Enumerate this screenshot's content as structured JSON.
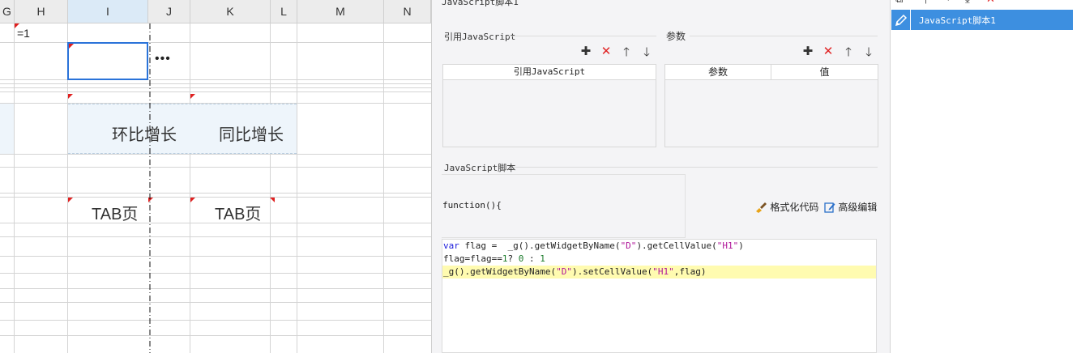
{
  "spreadsheet": {
    "columns": [
      "G",
      "H",
      "I",
      "J",
      "K",
      "L",
      "M",
      "N"
    ],
    "selected_column": "I",
    "cells": {
      "h1": "=1",
      "ellipsis": "•••",
      "i4": "环比增长",
      "k4": "同比增长",
      "i8": "TAB页",
      "k8": "TAB页"
    }
  },
  "panel": {
    "title": "JavaScript脚本1",
    "ref_section": {
      "title": "引用JavaScript",
      "table_header": "引用JavaScript"
    },
    "param_section": {
      "title": "参数",
      "headers": [
        "参数",
        "值"
      ]
    },
    "toolbar_icons": [
      "add-icon",
      "delete-icon",
      "move-up-icon",
      "move-down-icon"
    ],
    "toolbar_glyphs": {
      "add": "✚",
      "delete": "✕",
      "up": "🡑",
      "down": "🡓"
    },
    "script_section": {
      "title": "JavaScript脚本",
      "function_header": "function(){",
      "format_label": "格式化代码",
      "advanced_label": "高级编辑",
      "code": {
        "line1": {
          "kw": "var",
          "a": " flag =  _g().getWidgetByName(",
          "s1": "\"D\"",
          "b": ").getCellValue(",
          "s2": "\"H1\"",
          "c": ")"
        },
        "line2": {
          "a": "flag=flag==",
          "n1": "1",
          "b": "? ",
          "n2": "0",
          "c": " : ",
          "n3": "1"
        },
        "line3": {
          "a": "_g().getWidgetByName(",
          "s1": "\"D\"",
          "b": ").setCellValue(",
          "s2": "\"H1\"",
          "c": ",flag)"
        }
      }
    }
  },
  "right_panel": {
    "items": [
      {
        "label": "JavaScript脚本1",
        "selected": true
      }
    ],
    "toolbar_icons": [
      "copy-icon",
      "move-up-icon",
      "move-down-icon",
      "move-bottom-icon",
      "delete-icon"
    ]
  },
  "colors": {
    "accent": "#3d8fe0",
    "delete_red": "#e02424",
    "selection_blue": "#2a73d9",
    "highlight_line": "#fffbb0"
  }
}
